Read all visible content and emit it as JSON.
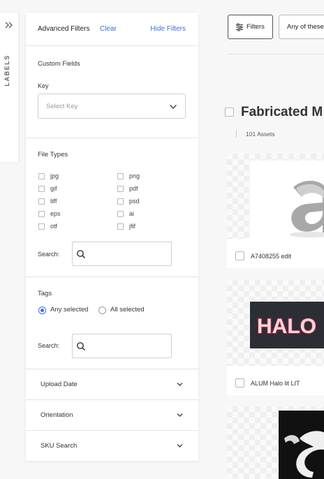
{
  "labels_rail": {
    "label": "LABELS"
  },
  "panel": {
    "title": "Advanced Filters",
    "clear_label": "Clear",
    "hide_label": "Hide Filters",
    "custom_fields": {
      "title": "Custom Fields",
      "key_label": "Key",
      "key_placeholder": "Select Key"
    },
    "file_types": {
      "title": "File Types",
      "left": [
        "jpg",
        "gif",
        "tiff",
        "eps",
        "otf"
      ],
      "right": [
        "png",
        "pdf",
        "psd",
        "ai",
        "jfif"
      ],
      "search_label": "Search:"
    },
    "tags": {
      "title": "Tags",
      "any_label": "Any selected",
      "all_label": "All selected",
      "selected": "any",
      "search_label": "Search:"
    },
    "collapsibles": [
      "Upload Date",
      "Orientation",
      "SKU Search"
    ]
  },
  "toolbar": {
    "filters_label": "Filters",
    "match_label": "Any of these"
  },
  "collection": {
    "title": "Fabricated M",
    "count": "101 Assets"
  },
  "assets": [
    {
      "name": "A7408255 edit"
    },
    {
      "name": "ALUM Halo lit LIT"
    }
  ],
  "colors": {
    "accent": "#3b6fd4"
  }
}
